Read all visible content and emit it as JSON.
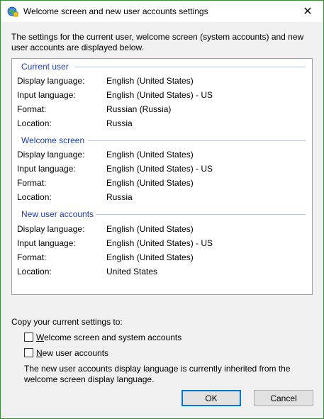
{
  "window": {
    "title": "Welcome screen and new user accounts settings",
    "close_glyph": "✕"
  },
  "intro": "The settings for the current user, welcome screen (system accounts) and new user accounts are displayed below.",
  "labels": {
    "display_language": "Display language:",
    "input_language": "Input language:",
    "format": "Format:",
    "location": "Location:"
  },
  "sections": [
    {
      "header": "Current user",
      "display_language": "English (United States)",
      "input_language": "English (United States) - US",
      "format": "Russian (Russia)",
      "location": "Russia"
    },
    {
      "header": "Welcome screen",
      "display_language": "English (United States)",
      "input_language": "English (United States) - US",
      "format": "English (United States)",
      "location": "Russia"
    },
    {
      "header": "New user accounts",
      "display_language": "English (United States)",
      "input_language": "English (United States) - US",
      "format": "English (United States)",
      "location": "United States"
    }
  ],
  "copy": {
    "label": "Copy your current settings to:",
    "welcome_first": "W",
    "welcome_rest": "elcome screen and system accounts",
    "welcome_checked": false,
    "new_first": "N",
    "new_rest": "ew user accounts",
    "new_checked": false
  },
  "note": "The new user accounts display language is currently inherited from the welcome screen display language.",
  "buttons": {
    "ok": "OK",
    "cancel": "Cancel"
  },
  "colors": {
    "section_header": "#1f3fa5",
    "window_border": "#3c8a3c",
    "default_button_border": "#0078d7"
  }
}
